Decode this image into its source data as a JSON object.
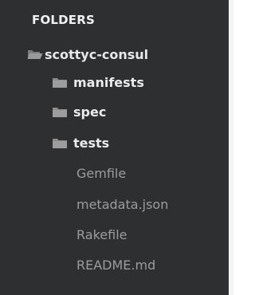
{
  "sidebar": {
    "header": "FOLDERS",
    "root": {
      "label": "scottyc-consul",
      "icon": "folder-open-icon"
    },
    "folders": [
      {
        "label": "manifests",
        "icon": "folder-icon"
      },
      {
        "label": "spec",
        "icon": "folder-icon"
      },
      {
        "label": "tests",
        "icon": "folder-icon"
      }
    ],
    "files": [
      {
        "label": "Gemfile"
      },
      {
        "label": "metadata.json"
      },
      {
        "label": "Rakefile"
      },
      {
        "label": "README.md"
      }
    ]
  },
  "colors": {
    "background": "#2d2f30",
    "folder_text": "#ebebeb",
    "file_text": "#9c9c9c",
    "icon": "#8e8e8e"
  }
}
